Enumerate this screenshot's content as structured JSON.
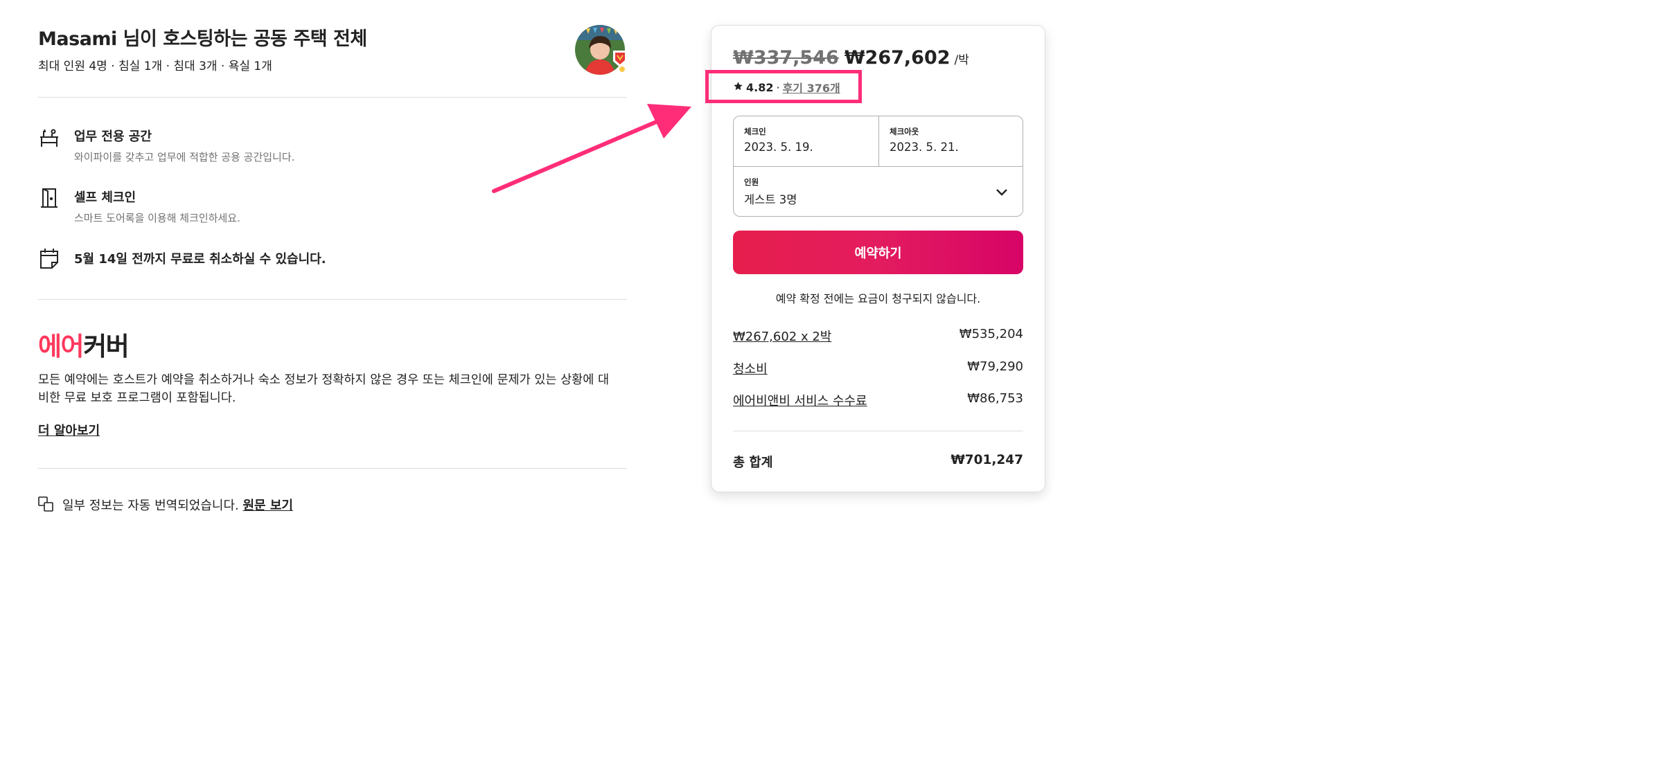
{
  "listing": {
    "title": "Masami 님이 호스팅하는 공동 주택 전체",
    "subtitle": "최대 인원 4명 · 침실 1개 · 침대 3개 · 욕실 1개"
  },
  "features": [
    {
      "icon": "desk-icon",
      "title": "업무 전용 공간",
      "desc": "와이파이를 갖추고 업무에 적합한 공용 공간입니다."
    },
    {
      "icon": "door-icon",
      "title": "셀프 체크인",
      "desc": "스마트 도어록을 이용해 체크인하세요."
    },
    {
      "icon": "calendar-icon",
      "title": "5월 14일 전까지 무료로 취소하실 수 있습니다."
    }
  ],
  "aircover": {
    "brand_red": "에어",
    "brand_black": "커버",
    "description": "모든 예약에는 호스트가 예약을 취소하거나 숙소 정보가 정확하지 않은 경우 또는 체크인에 문제가 있는 상황에 대비한 무료 보호 프로그램이 포함됩니다.",
    "learn_more": "더 알아보기"
  },
  "translation": {
    "text": "일부 정보는 자동 번역되었습니다.",
    "link": "원문 보기"
  },
  "booking": {
    "old_price": "₩337,546",
    "price": "₩267,602",
    "per_night": "/박",
    "rating": "4.82",
    "separator": "·",
    "reviews": "후기 376개",
    "checkin_label": "체크인",
    "checkin_value": "2023. 5. 19.",
    "checkout_label": "체크아웃",
    "checkout_value": "2023. 5. 21.",
    "guests_label": "인원",
    "guests_value": "게스트 3명",
    "reserve_label": "예약하기",
    "notice": "예약 확정 전에는 요금이 청구되지 않습니다.",
    "line_items": [
      {
        "label": "₩267,602 x 2박",
        "amount": "₩535,204"
      },
      {
        "label": "청소비",
        "amount": "₩79,290"
      },
      {
        "label": "에어비앤비 서비스 수수료",
        "amount": "₩86,753"
      }
    ],
    "total_label": "총 합계",
    "total_amount": "₩701,247"
  },
  "colors": {
    "brand": "#ff385c",
    "annotation": "#ff2d78",
    "reserve_gradient_start": "#e61e4d",
    "reserve_gradient_end": "#d70466"
  }
}
